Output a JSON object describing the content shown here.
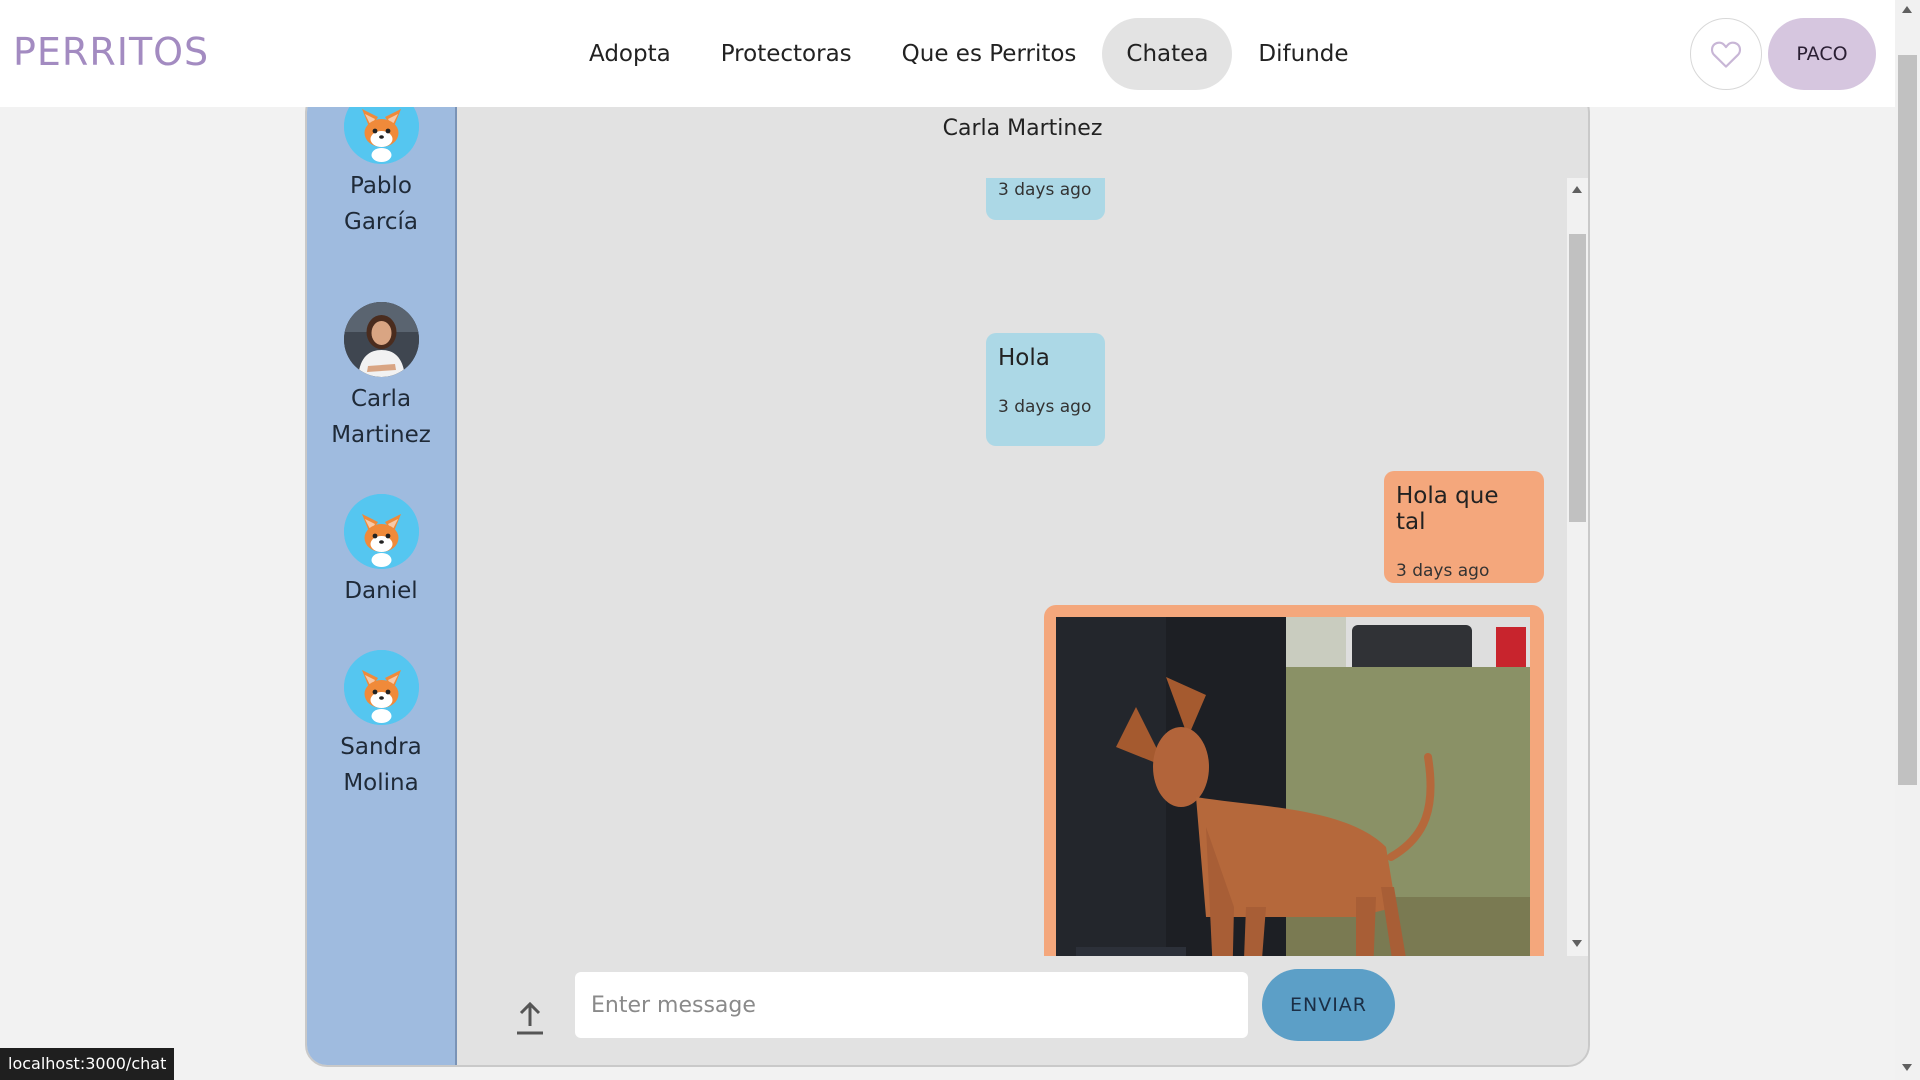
{
  "header": {
    "logo": "PERRITOS",
    "nav": [
      {
        "label": "Adopta",
        "active": false
      },
      {
        "label": "Protectoras",
        "active": false
      },
      {
        "label": "Que es Perritos",
        "active": false
      },
      {
        "label": "Chatea",
        "active": true
      },
      {
        "label": "Difunde",
        "active": false
      }
    ],
    "favorites_icon": "heart-outline-icon",
    "user_label": "PACO"
  },
  "contacts": [
    {
      "name": "Pablo García",
      "avatar": "corgi-avatar"
    },
    {
      "name": "Carla Martinez",
      "avatar": "photo-avatar"
    },
    {
      "name": "Daniel",
      "avatar": "corgi-avatar"
    },
    {
      "name": "Sandra Molina",
      "avatar": "corgi-avatar"
    }
  ],
  "chat": {
    "title": "Carla Martinez",
    "messages": [
      {
        "direction": "incoming",
        "text": "",
        "time": "3 days ago"
      },
      {
        "direction": "incoming",
        "text": "Hola",
        "time": "3 days ago"
      },
      {
        "direction": "outgoing",
        "text": "Hola que tal",
        "time": "3 days ago"
      },
      {
        "direction": "outgoing",
        "type": "image",
        "image": "brown-podenco-dog-photo"
      }
    ],
    "composer": {
      "placeholder": "Enter message",
      "send_label": "ENVIAR",
      "upload_icon": "upload-arrow-icon"
    }
  },
  "status_bar": {
    "url": "localhost:3000/chat"
  },
  "colors": {
    "logo": "#a38bc1",
    "sidebar": "#9fbbdf",
    "incoming_bubble": "#acd8e6",
    "outgoing_bubble": "#f4a77c",
    "send_button": "#5c9fc7",
    "user_button": "#d6c6df"
  }
}
